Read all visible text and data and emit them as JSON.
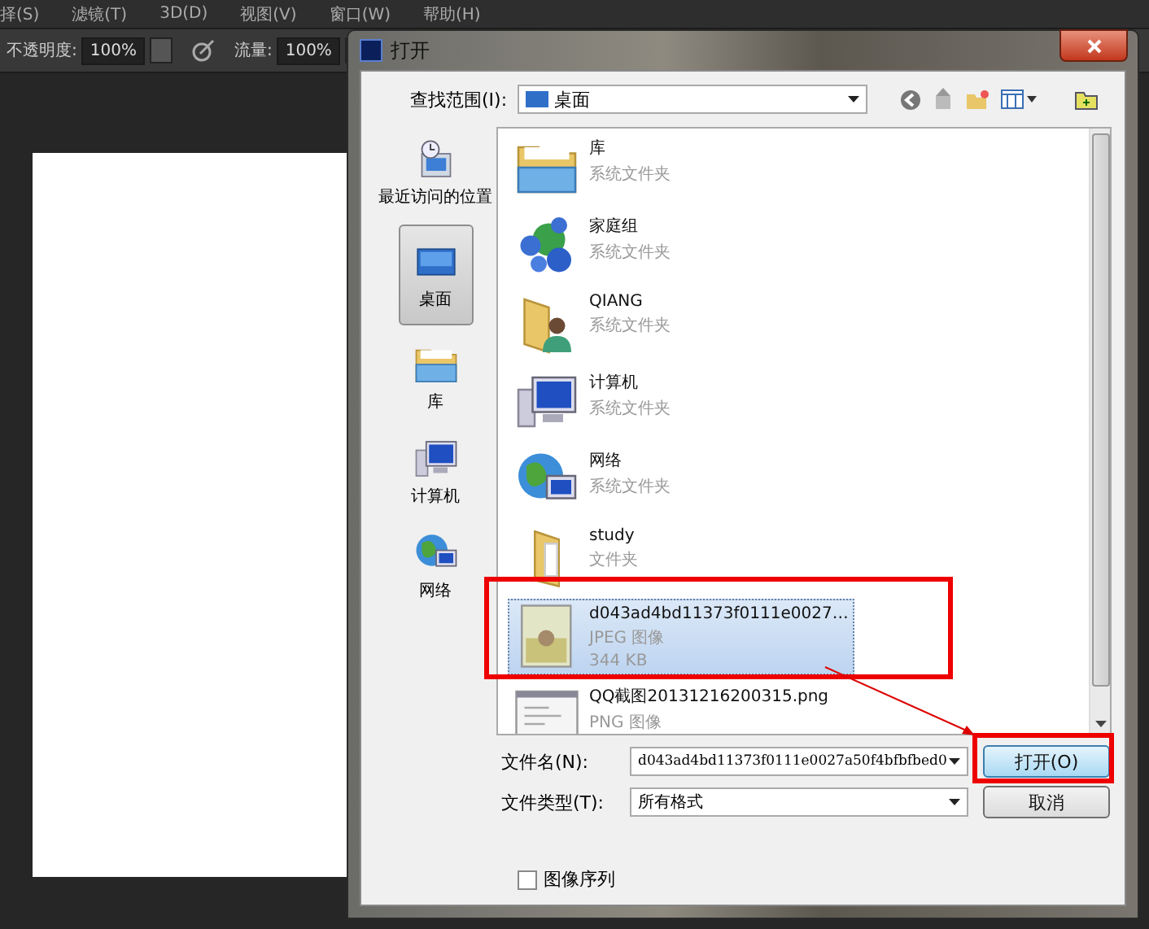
{
  "menu": [
    {
      "label": "择(S)"
    },
    {
      "label": "滤镜(T)"
    },
    {
      "label": "3D(D)"
    },
    {
      "label": "视图(V)"
    },
    {
      "label": "窗口(W)"
    },
    {
      "label": "帮助(H)"
    }
  ],
  "options_bar": {
    "opacity_label": "不透明度:",
    "opacity_value": "100%",
    "flow_label": "流量:",
    "flow_value": "100%"
  },
  "dialog": {
    "title": "打开",
    "look_in_label": "查找范围(I):",
    "look_in_value": "桌面",
    "places": [
      {
        "label": "最近访问的位置",
        "kind": "recent",
        "selected": false
      },
      {
        "label": "桌面",
        "kind": "desktop",
        "selected": true
      },
      {
        "label": "库",
        "kind": "library",
        "selected": false
      },
      {
        "label": "计算机",
        "kind": "computer",
        "selected": false
      },
      {
        "label": "网络",
        "kind": "network",
        "selected": false
      }
    ],
    "files": [
      {
        "name": "库",
        "details": [
          "系统文件夹"
        ],
        "kind": "library",
        "selected": false
      },
      {
        "name": "家庭组",
        "details": [
          "系统文件夹"
        ],
        "kind": "homegroup",
        "selected": false
      },
      {
        "name": "QIANG",
        "details": [
          "系统文件夹"
        ],
        "kind": "user",
        "selected": false
      },
      {
        "name": "计算机",
        "details": [
          "系统文件夹"
        ],
        "kind": "computer",
        "selected": false
      },
      {
        "name": "网络",
        "details": [
          "系统文件夹"
        ],
        "kind": "network",
        "selected": false
      },
      {
        "name": "study",
        "details": [
          "文件夹"
        ],
        "kind": "folder",
        "selected": false
      },
      {
        "name": "d043ad4bd11373f0111e0027…",
        "details": [
          "JPEG 图像",
          "344 KB"
        ],
        "kind": "photo",
        "selected": true
      },
      {
        "name": "QQ截图20131216200315.png",
        "details": [
          "PNG 图像"
        ],
        "kind": "screenshot",
        "selected": false
      }
    ],
    "file_name_label": "文件名(N):",
    "file_name_value": "d043ad4bd11373f0111e0027a50f4bfbfbed0",
    "file_type_label": "文件类型(T):",
    "file_type_value": "所有格式",
    "buttons": [
      {
        "label": "打开(O)",
        "kind": "primary"
      },
      {
        "label": "取消",
        "kind": "secondary"
      }
    ],
    "image_sequence": {
      "label": "图像序列",
      "checked": false
    }
  }
}
